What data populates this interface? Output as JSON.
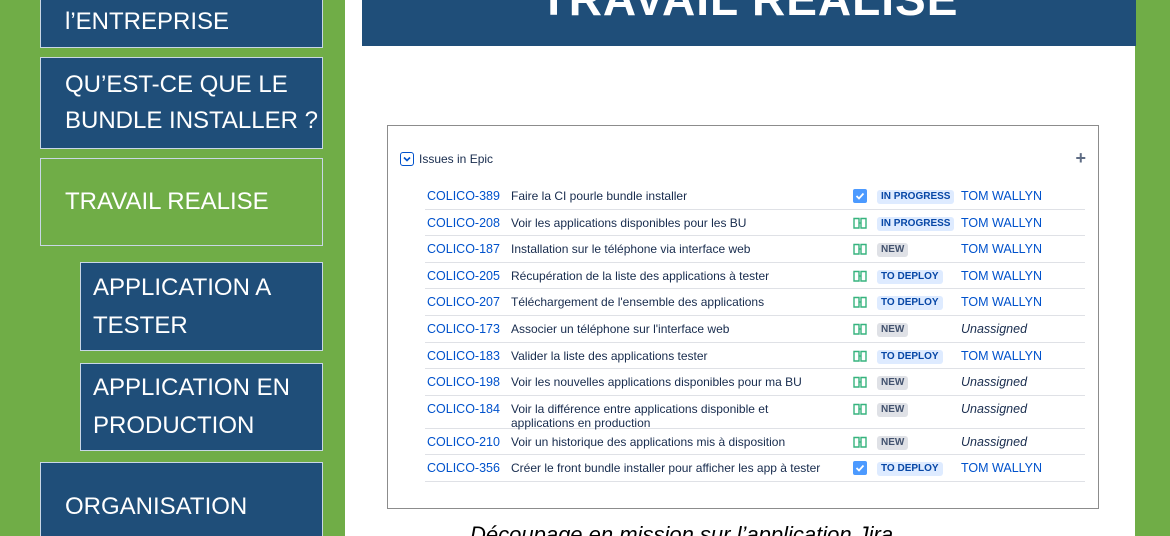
{
  "nav": {
    "entreprise": "l’ENTREPRISE",
    "bundle_line1": "QU’EST-CE QUE LE",
    "bundle_line2": "BUNDLE INSTALLER ?",
    "travail": "TRAVAIL REALISE",
    "app_tester_line1": "APPLICATION A",
    "app_tester_line2": "TESTER",
    "app_prod_line1": "APPLICATION EN",
    "app_prod_line2": "PRODUCTION",
    "organisation": "ORGANISATION"
  },
  "slide": {
    "title": "TRAVAIL REALISE",
    "caption": "Découpage en mission sur l’application Jira"
  },
  "panel": {
    "title": "Issues in Epic",
    "add_icon": "+",
    "issues": [
      {
        "key": "COLICO-389",
        "summary": "Faire la CI pourle bundle installer",
        "type": "task",
        "status": "IN PROGRESS",
        "assignee": "TOM WALLYN"
      },
      {
        "key": "COLICO-208",
        "summary": "Voir les applications disponibles pour les BU",
        "type": "story",
        "status": "IN PROGRESS",
        "assignee": "TOM WALLYN"
      },
      {
        "key": "COLICO-187",
        "summary": "Installation sur le téléphone via interface web",
        "type": "story",
        "status": "NEW",
        "assignee": "TOM WALLYN"
      },
      {
        "key": "COLICO-205",
        "summary": "Récupération de la liste des applications à tester",
        "type": "story",
        "status": "TO DEPLOY",
        "assignee": "TOM WALLYN"
      },
      {
        "key": "COLICO-207",
        "summary": "Téléchargement de l'ensemble des applications",
        "type": "story",
        "status": "TO DEPLOY",
        "assignee": "TOM WALLYN"
      },
      {
        "key": "COLICO-173",
        "summary": "Associer un téléphone sur l'interface web",
        "type": "story",
        "status": "NEW",
        "assignee": "Unassigned"
      },
      {
        "key": "COLICO-183",
        "summary": "Valider la liste des applications tester",
        "type": "story",
        "status": "TO DEPLOY",
        "assignee": "TOM WALLYN"
      },
      {
        "key": "COLICO-198",
        "summary": "Voir les nouvelles applications disponibles pour ma BU",
        "type": "story",
        "status": "NEW",
        "assignee": "Unassigned"
      },
      {
        "key": "COLICO-184",
        "summary": "Voir la différence entre applications disponible et applications en production",
        "type": "story",
        "status": "NEW",
        "assignee": "Unassigned"
      },
      {
        "key": "COLICO-210",
        "summary": "Voir un historique des applications mis à disposition",
        "type": "story",
        "status": "NEW",
        "assignee": "Unassigned"
      },
      {
        "key": "COLICO-356",
        "summary": "Créer le front bundle installer pour afficher les app à tester",
        "type": "task",
        "status": "TO DEPLOY",
        "assignee": "TOM WALLYN"
      }
    ]
  },
  "colors": {
    "navy": "#1f4e79",
    "green": "#70ad47",
    "jira_blue": "#0052cc",
    "story_green": "#36b37e"
  }
}
